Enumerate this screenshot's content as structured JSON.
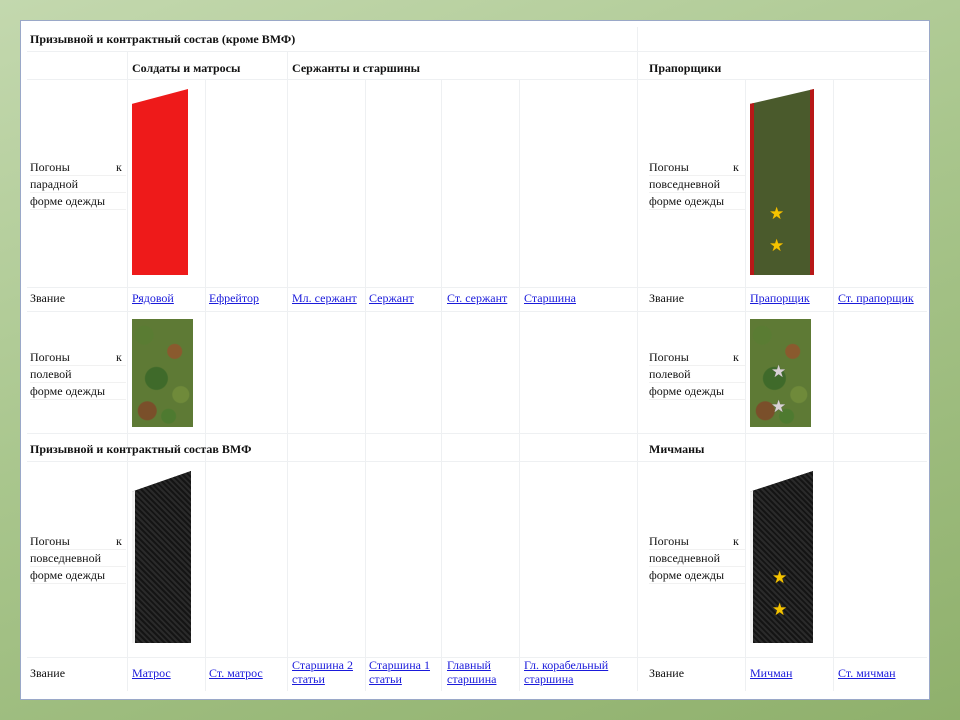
{
  "sections": {
    "army_title": "Призывной и контрактный состав (кроме ВМФ)",
    "soldiers_header": "Солдаты и матросы",
    "sergeants_header": "Сержанты и старшины",
    "warrant_header": "Прапорщики",
    "navy_title": "Призывной и контрактный состав ВМФ",
    "midshipmen_header": "Мичманы"
  },
  "row_labels": {
    "parade": [
      "Погоны",
      "парадной",
      "форме одежды"
    ],
    "daily": [
      "Погоны",
      "повседневной",
      "форме одежды"
    ],
    "field": [
      "Погоны",
      "полевой",
      "форме одежды"
    ],
    "k": "к",
    "rank": "Звание"
  },
  "army_ranks": [
    "Рядовой",
    "Ефрейтор",
    "Мл. сержант",
    "Сержант",
    "Ст. сержант",
    "Старшина"
  ],
  "warrant_ranks": [
    "Прапорщик",
    "Ст. прапорщик"
  ],
  "navy_ranks": [
    "Матрос",
    "Ст. матрос",
    "Старшина 2 статьи",
    "Старшина 1 статьи",
    "Главный старшина",
    "Гл. корабельный старшина"
  ],
  "midshipman_ranks": [
    "Мичман",
    "Ст. мичман"
  ],
  "stars": {
    "warrant_daily": [
      "★",
      "★"
    ],
    "warrant_field": [
      "★",
      "★"
    ],
    "midshipman_daily": [
      "★",
      "★"
    ]
  },
  "colors": {
    "parade_epaulette": "#ee1a1a",
    "daily_epaulette": "#4a5a2c",
    "piping": "#b81818",
    "navy_epaulette": "#1a1a1a",
    "star_gold": "#f5c400",
    "link": "#1a1adb"
  }
}
